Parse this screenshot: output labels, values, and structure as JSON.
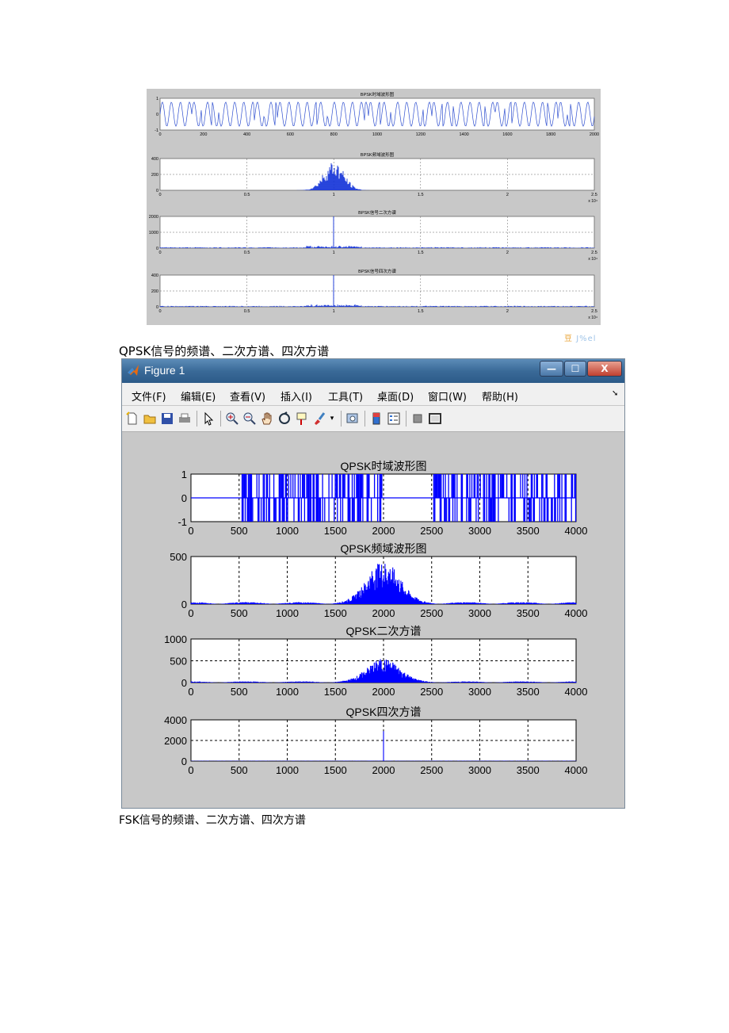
{
  "watermark": {
    "part1": "豆",
    "part2": "J%el"
  },
  "captions": {
    "qpsk": "QPSK信号的频谱、二次方谱、四次方谱",
    "fsk": "FSK信号的频谱、二次方谱、四次方谱"
  },
  "bpsk_figure": {
    "panels": [
      {
        "title": "BPSK时域波形图",
        "xticks": [
          "0",
          "200",
          "400",
          "600",
          "800",
          "1000",
          "1200",
          "1400",
          "1600",
          "1800",
          "2000"
        ],
        "yticks": [
          "1",
          "0",
          "-1"
        ]
      },
      {
        "title": "BPSK频域波形图",
        "xticks": [
          "0",
          "0.5",
          "1",
          "1.5",
          "2",
          "2.5"
        ],
        "yticks": [
          "400",
          "200",
          "0"
        ],
        "multiplier": "x 10⁴"
      },
      {
        "title": "BPSK信号二次方谱",
        "xticks": [
          "0",
          "0.5",
          "1",
          "1.5",
          "2",
          "2.5"
        ],
        "yticks": [
          "2000",
          "1000",
          "0"
        ],
        "multiplier": "x 10⁴"
      },
      {
        "title": "BPSK信号四次方谱",
        "xticks": [
          "0",
          "0.5",
          "1",
          "1.5",
          "2",
          "2.5"
        ],
        "yticks": [
          "400",
          "200",
          "0"
        ],
        "multiplier": "x 10⁴"
      }
    ]
  },
  "window": {
    "title": "Figure 1",
    "buttons": {
      "minimize": "—",
      "maximize": "☐",
      "close": "X"
    },
    "menu": [
      "文件(F)",
      "编辑(E)",
      "查看(V)",
      "插入(I)",
      "工具(T)",
      "桌面(D)",
      "窗口(W)",
      "帮助(H)"
    ],
    "toolbar_icons": [
      "new-file-icon",
      "open-folder-icon",
      "save-icon",
      "print-icon",
      "pointer-icon",
      "zoom-in-icon",
      "zoom-out-icon",
      "pan-hand-icon",
      "rotate-3d-icon",
      "data-cursor-icon",
      "brush-icon",
      "link-plot-icon",
      "colorbar-icon",
      "legend-icon",
      "hide-plot-tools-icon",
      "show-plot-tools-icon"
    ]
  },
  "colors": {
    "signal": "#0000ff",
    "figure_bg": "#c8c8c8",
    "axes_bg": "#ffffff"
  },
  "chart_data": [
    {
      "type": "line",
      "title": "QPSK时域波形图",
      "xlim": [
        0,
        4000
      ],
      "ylim": [
        -1,
        1
      ],
      "xticks": [
        "0",
        "500",
        "1000",
        "1500",
        "2000",
        "2500",
        "3000",
        "3500",
        "4000"
      ],
      "yticks": [
        "1",
        "0",
        "-1"
      ],
      "grid": true
    },
    {
      "type": "line",
      "title": "QPSK频域波形图",
      "xlim": [
        0,
        4000
      ],
      "ylim": [
        0,
        500
      ],
      "xticks": [
        "0",
        "500",
        "1000",
        "1500",
        "2000",
        "2500",
        "3000",
        "3500",
        "4000"
      ],
      "yticks": [
        "500",
        "0"
      ],
      "grid": true
    },
    {
      "type": "line",
      "title": "QPSK二次方谱",
      "xlim": [
        0,
        4000
      ],
      "ylim": [
        0,
        1000
      ],
      "xticks": [
        "0",
        "500",
        "1000",
        "1500",
        "2000",
        "2500",
        "3000",
        "3500",
        "4000"
      ],
      "yticks": [
        "1000",
        "500",
        "0"
      ],
      "grid": true
    },
    {
      "type": "line",
      "title": "QPSK四次方谱",
      "xlim": [
        0,
        4000
      ],
      "ylim": [
        0,
        4000
      ],
      "xticks": [
        "0",
        "500",
        "1000",
        "1500",
        "2000",
        "2500",
        "3000",
        "3500",
        "4000"
      ],
      "yticks": [
        "4000",
        "2000",
        "0"
      ],
      "grid": true
    }
  ]
}
